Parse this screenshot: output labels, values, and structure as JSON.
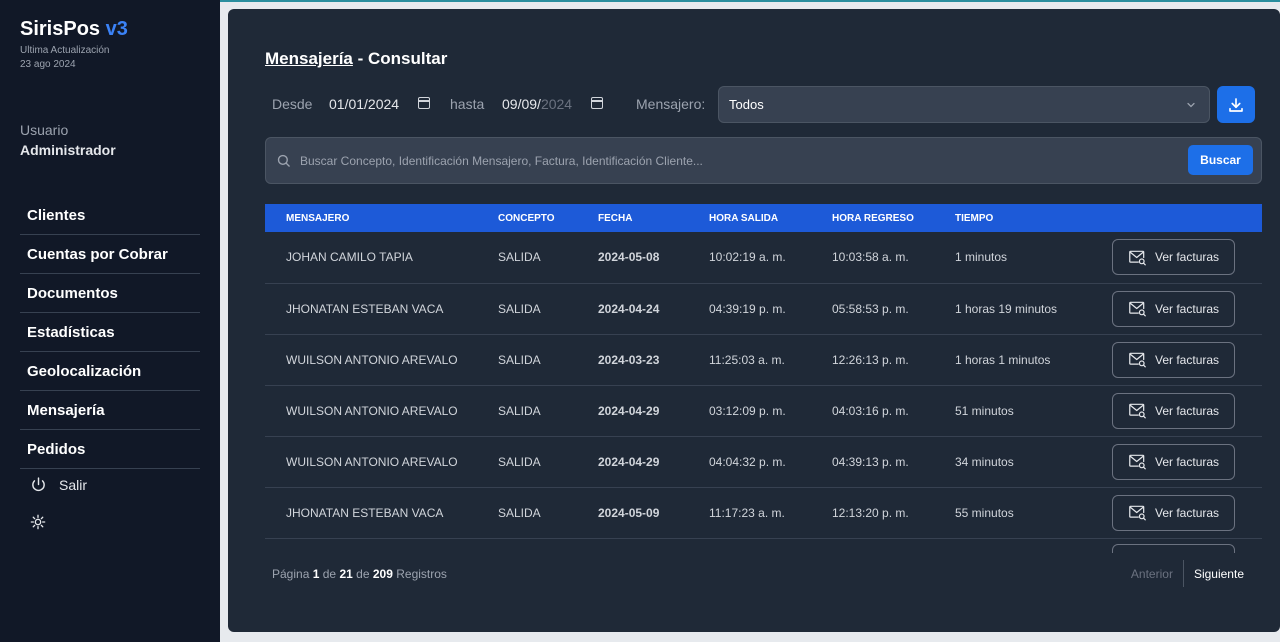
{
  "sidebar": {
    "brand": "SirisPos",
    "brand_version": "v3",
    "updated_label": "Ultima Actualización",
    "updated_date": "23 ago 2024",
    "user_label": "Usuario",
    "user_name": "Administrador",
    "nav": [
      "Clientes",
      "Cuentas por Cobrar",
      "Documentos",
      "Estadísticas",
      "Geolocalización",
      "Mensajería",
      "Pedidos"
    ],
    "logout_label": "Salir"
  },
  "page": {
    "crumb": "Mensajería",
    "title_suffix": " - Consultar"
  },
  "filters": {
    "from_label": "Desde",
    "from_value": "01/01/2024",
    "to_label": "hasta",
    "to_value_main": "09/09/",
    "to_value_dim": "2024",
    "messenger_label": "Mensajero:",
    "messenger_value": "Todos"
  },
  "search": {
    "placeholder": "Buscar Concepto, Identificación Mensajero, Factura, Identificación Cliente...",
    "button": "Buscar"
  },
  "table": {
    "headers": [
      "MENSAJERO",
      "CONCEPTO",
      "FECHA",
      "HORA SALIDA",
      "HORA REGRESO",
      "TIEMPO"
    ],
    "action_label": "Ver facturas",
    "rows": [
      {
        "mensajero": "JOHAN CAMILO TAPIA",
        "concepto": "SALIDA",
        "fecha": "2024-05-08",
        "salida": "10:02:19 a. m.",
        "regreso": "10:03:58 a. m.",
        "tiempo": "1  minutos"
      },
      {
        "mensajero": "JHONATAN ESTEBAN VACA",
        "concepto": "SALIDA",
        "fecha": "2024-04-24",
        "salida": "04:39:19 p. m.",
        "regreso": "05:58:53 p. m.",
        "tiempo": "1 horas  19  minutos"
      },
      {
        "mensajero": "WUILSON ANTONIO AREVALO",
        "concepto": "SALIDA",
        "fecha": "2024-03-23",
        "salida": "11:25:03 a. m.",
        "regreso": "12:26:13 p. m.",
        "tiempo": "1 horas  1  minutos"
      },
      {
        "mensajero": "WUILSON ANTONIO AREVALO",
        "concepto": "SALIDA",
        "fecha": "2024-04-29",
        "salida": "03:12:09 p. m.",
        "regreso": "04:03:16 p. m.",
        "tiempo": "51  minutos"
      },
      {
        "mensajero": "WUILSON ANTONIO AREVALO",
        "concepto": "SALIDA",
        "fecha": "2024-04-29",
        "salida": "04:04:32 p. m.",
        "regreso": "04:39:13 p. m.",
        "tiempo": "34  minutos"
      },
      {
        "mensajero": "JHONATAN ESTEBAN VACA",
        "concepto": "SALIDA",
        "fecha": "2024-05-09",
        "salida": "11:17:23 a. m.",
        "regreso": "12:13:20 p. m.",
        "tiempo": "55  minutos"
      }
    ]
  },
  "pagination": {
    "page_word": "Página",
    "current": "1",
    "of_word": "de",
    "total_pages": "21",
    "total_records": "209",
    "records_word": "Registros",
    "prev": "Anterior",
    "next": "Siguiente"
  }
}
